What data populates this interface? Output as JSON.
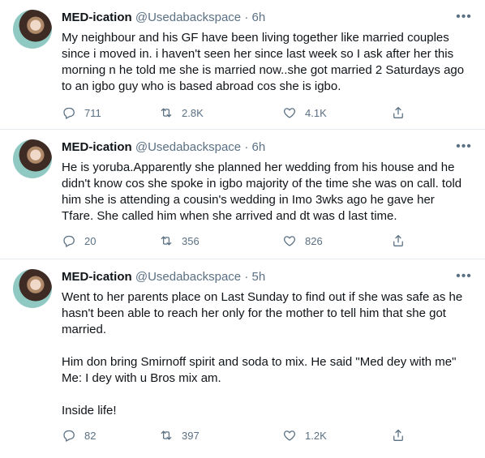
{
  "tweets": [
    {
      "name": "MED-ication",
      "handle": "@Usedabackspace",
      "time": " · 6h",
      "text": "My neighbour and his GF have been living together like married couples since i moved in. i haven't seen her since last week so I ask after her this morning n he told me she is married now..she got married 2 Saturdays ago to an igbo guy who is based abroad cos she is igbo.",
      "replies": "711",
      "retweets": "2.8K",
      "likes": "4.1K"
    },
    {
      "name": "MED-ication",
      "handle": "@Usedabackspace",
      "time": " · 6h",
      "text": "He is yoruba.Apparently she planned her wedding from his house and he didn't know cos she spoke in igbo majority of the time she was on call. told him she is attending a cousin's wedding in Imo 3wks ago he gave her Tfare. She called him when she arrived and dt was d last time.",
      "replies": "20",
      "retweets": "356",
      "likes": "826"
    },
    {
      "name": "MED-ication",
      "handle": "@Usedabackspace",
      "time": " · 5h",
      "text": "Went to her parents place on Last Sunday to find out if she was safe as he hasn't been able to reach her only for the mother to tell him that she got married.\n\nHim don bring Smirnoff spirit and soda to mix. He said \"Med dey with me\"\nMe: I dey with u Bros mix am.\n\nInside life!",
      "replies": "82",
      "retweets": "397",
      "likes": "1.2K"
    }
  ],
  "icons": {
    "more": "more-icon",
    "reply": "reply-icon",
    "retweet": "retweet-icon",
    "like": "heart-icon",
    "share": "share-icon"
  },
  "colors": {
    "secondary": "#5b7083",
    "text": "#0f1419",
    "divider": "#e6ecf0"
  }
}
